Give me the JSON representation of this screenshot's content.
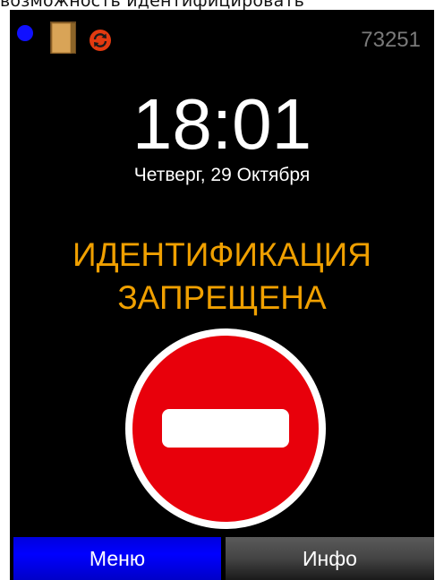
{
  "caption": "возможность идентифицировать",
  "status_bar": {
    "device_id": "73251",
    "indicator_color": "#1010ff",
    "icons": [
      "status-dot-icon",
      "door-icon",
      "sync-icon"
    ]
  },
  "clock": {
    "time": "18:01",
    "date": "Четверг, 29 Октября"
  },
  "status": {
    "line1": "ИДЕНТИФИКАЦИЯ",
    "line2": "ЗАПРЕЩЕНА",
    "color": "#f0a000",
    "sign_icon": "no-entry-sign-icon"
  },
  "buttons": {
    "menu": "Меню",
    "info": "Инфо"
  }
}
